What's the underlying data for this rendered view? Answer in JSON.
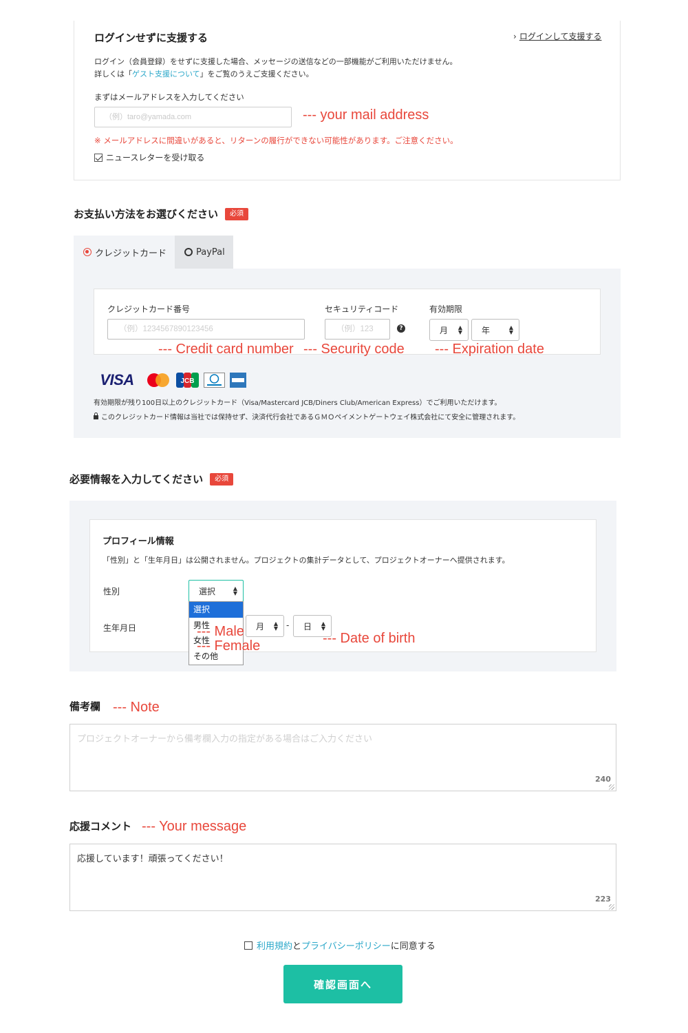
{
  "guest": {
    "title": "ログインせずに支援する",
    "login_link": "ログインして支援する",
    "desc_line1": "ログイン（会員登録）をせずに支援した場合、メッセージの送信などの一部機能がご利用いただけません。",
    "desc_line2_pre": "詳しくは「",
    "desc_link": "ゲスト支援について",
    "desc_line2_post": "」をご覧のうえご支援ください。",
    "email_label": "まずはメールアドレスを入力してください",
    "email_placeholder": "（例）taro@yamada.com",
    "email_warning": "※ メールアドレスに間違いがあると、リターンの履行ができない可能性があります。ご注意ください。",
    "newsletter_label": "ニュースレターを受け取る",
    "newsletter_checked": true
  },
  "payment": {
    "title": "お支払い方法をお選びください",
    "required_badge": "必須",
    "tabs": [
      {
        "label": "クレジットカード",
        "selected": true
      },
      {
        "label": "PayPal",
        "selected": false
      }
    ],
    "card_number_label": "クレジットカード番号",
    "card_number_placeholder": "（例）1234567890123456",
    "security_label": "セキュリティコード",
    "security_placeholder": "（例）123",
    "expiry_label": "有効期限",
    "expiry_month": "月",
    "expiry_year": "年",
    "brands": [
      "VISA",
      "MasterCard",
      "JCB",
      "Diners Club",
      "American Express"
    ],
    "note1": "有効期限が残り100日以上のクレジットカード（Visa/Mastercard JCB/Diners Club/American Express）でご利用いただけます。",
    "note2": "このクレジットカード情報は当社では保持せず、決済代行会社であるＧＭＯペイメントゲートウェイ株式会社にて安全に管理されます。"
  },
  "info": {
    "title": "必要情報を入力してください",
    "required_badge": "必須",
    "profile_title": "プロフィール情報",
    "profile_desc": "「性別」と「生年月日」は公開されません。プロジェクトの集計データとして、プロジェクトオーナーへ提供されます。",
    "gender_label": "性別",
    "gender_value": "選択",
    "gender_options": [
      "選択",
      "男性",
      "女性",
      "その他"
    ],
    "birth_label": "生年月日",
    "birth_month": "月",
    "birth_dash": "-",
    "birth_day": "日"
  },
  "note": {
    "title": "備考欄",
    "placeholder": "プロジェクトオーナーから備考欄入力の指定がある場合はご入力ください",
    "counter": "240"
  },
  "comment": {
    "title": "応援コメント",
    "value": "応援しています！頑張ってください！",
    "counter": "223"
  },
  "agree": {
    "terms_link": "利用規約",
    "and": "と",
    "privacy_link": "プライバシーポリシー",
    "suffix": "に同意する"
  },
  "submit_label": "確認画面へ",
  "annotations": {
    "email": "--- your mail address",
    "card_number": "--- Credit card number",
    "security": "--- Security code",
    "expiry": "--- Expiration date",
    "male": "--- Male",
    "female": "--- Female",
    "birth": "--- Date of birth",
    "note": "--- Note",
    "message": "--- Your message"
  },
  "colors": {
    "accent_red": "#e8473b",
    "link_blue": "#2aa7c9",
    "submit_green": "#1dbfa4",
    "panel_gray": "#f2f4f7"
  }
}
